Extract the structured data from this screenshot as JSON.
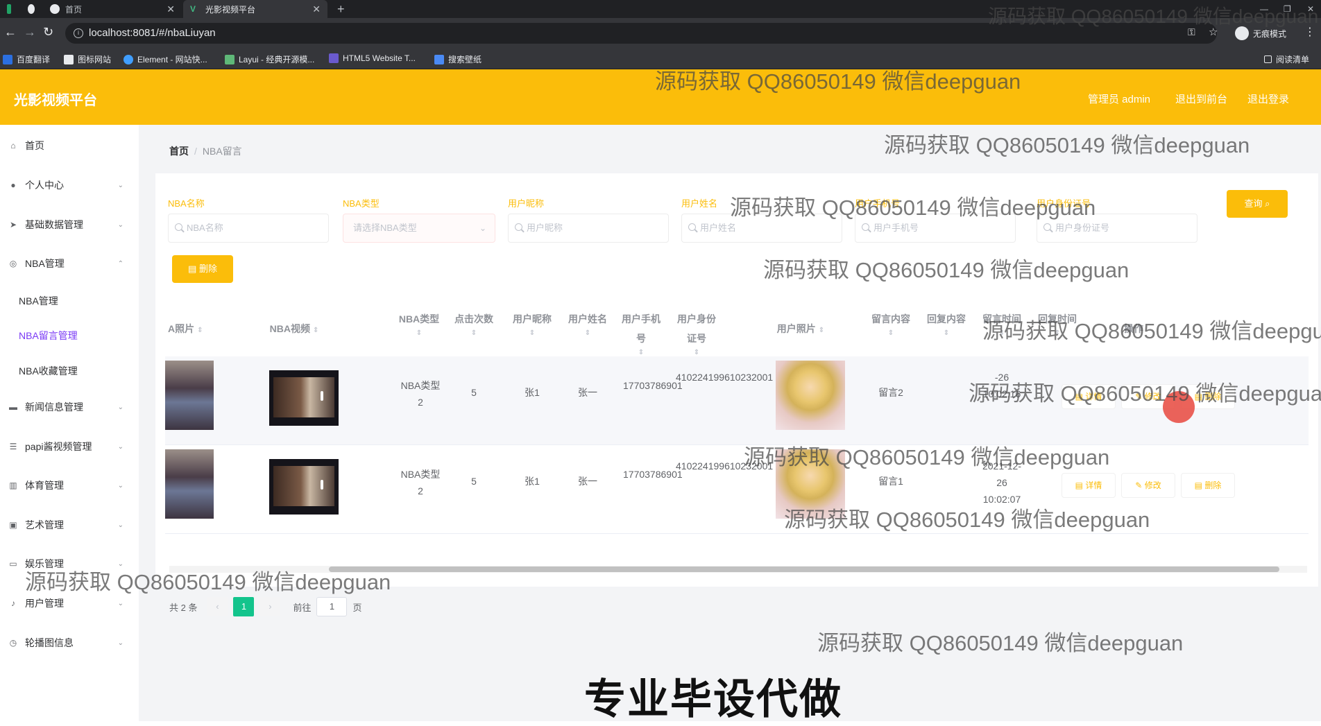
{
  "browser": {
    "tabs": [
      {
        "label": "首页",
        "active": false
      },
      {
        "label": "光影视频平台",
        "active": true
      }
    ],
    "new_tab": "+",
    "url": "localhost:8081/#/nbaLiuyan",
    "incognito_label": "无痕模式",
    "reading_list": "阅读清单",
    "bookmarks": [
      "百度翻译",
      "图标网站",
      "Element - 网站快...",
      "Layui - 经典开源模...",
      "HTML5 Website T...",
      "搜索壁纸"
    ]
  },
  "header": {
    "brand": "光影视频平台",
    "admin_label": "管理员 admin",
    "back_label": "退出到前台",
    "logout_label": "退出登录"
  },
  "sidebar": {
    "items": [
      {
        "label": "首页",
        "icon": "home-icon",
        "has_arrow": false
      },
      {
        "label": "个人中心",
        "icon": "user-icon",
        "has_arrow": true
      },
      {
        "label": "基础数据管理",
        "icon": "send-icon",
        "has_arrow": true
      },
      {
        "label": "NBA管理",
        "icon": "basketball-icon",
        "has_arrow": true,
        "expanded": true
      }
    ],
    "subitems": [
      {
        "label": "NBA管理",
        "active": false
      },
      {
        "label": "NBA留言管理",
        "active": true
      },
      {
        "label": "NBA收藏管理",
        "active": false
      }
    ],
    "items_after": [
      {
        "label": "新闻信息管理",
        "icon": "news-icon"
      },
      {
        "label": "papi酱视频管理",
        "icon": "list-icon"
      },
      {
        "label": "体育管理",
        "icon": "chart-icon"
      },
      {
        "label": "艺术管理",
        "icon": "art-icon"
      },
      {
        "label": "娱乐管理",
        "icon": "chat-icon"
      },
      {
        "label": "用户管理",
        "icon": "mic-icon"
      },
      {
        "label": "轮播图信息",
        "icon": "clock-icon"
      }
    ]
  },
  "breadcrumb": {
    "home": "首页",
    "separator": "/",
    "current": "NBA留言"
  },
  "filters": [
    {
      "label": "NBA名称",
      "placeholder": "NBA名称",
      "type": "input"
    },
    {
      "label": "NBA类型",
      "placeholder": "请选择NBA类型",
      "type": "select"
    },
    {
      "label": "用户昵称",
      "placeholder": "用户昵称",
      "type": "input"
    },
    {
      "label": "用户姓名",
      "placeholder": "用户姓名",
      "type": "input"
    },
    {
      "label": "用户手机号",
      "placeholder": "用户手机号",
      "type": "input"
    },
    {
      "label": "用户身份证号",
      "placeholder": "用户身份证号",
      "type": "input"
    }
  ],
  "buttons": {
    "query": "查询",
    "delete": "删除"
  },
  "table": {
    "columns": [
      "A照片",
      "NBA视频",
      "NBA类型",
      "点击次数",
      "用户昵称",
      "用户姓名",
      "用户手机号",
      "用户身份证号",
      "用户照片",
      "留言内容",
      "回复内容",
      "留言时间",
      "回复时间",
      "操作"
    ],
    "rows": [
      {
        "nba_type": "NBA类型2",
        "clicks": "5",
        "nickname": "张1",
        "name": "张一",
        "phone": "17703786901",
        "id_card": "410224199610232001",
        "message": "留言2",
        "reply": "",
        "msg_time": "-26 10:02:16"
      },
      {
        "nba_type": "NBA类型2",
        "clicks": "5",
        "nickname": "张1",
        "name": "张一",
        "phone": "17703786901",
        "id_card": "410224199610232001",
        "message": "留言1",
        "reply": "",
        "msg_time": "2021-12-26 10:02:07"
      }
    ],
    "ops": {
      "detail": "详情",
      "edit": "修改",
      "delete": "删除"
    }
  },
  "pagination": {
    "total": "共 2 条",
    "current": "1",
    "goto_prefix": "前往",
    "goto_value": "1",
    "goto_suffix": "页"
  },
  "overlay": {
    "watermark": "源码获取 QQ86050149 微信deepguan",
    "slogan": "专业毕设代做"
  },
  "colors": {
    "accent": "#fbbd0a",
    "active_menu": "#7a39f5",
    "page_active": "#13c48c"
  }
}
